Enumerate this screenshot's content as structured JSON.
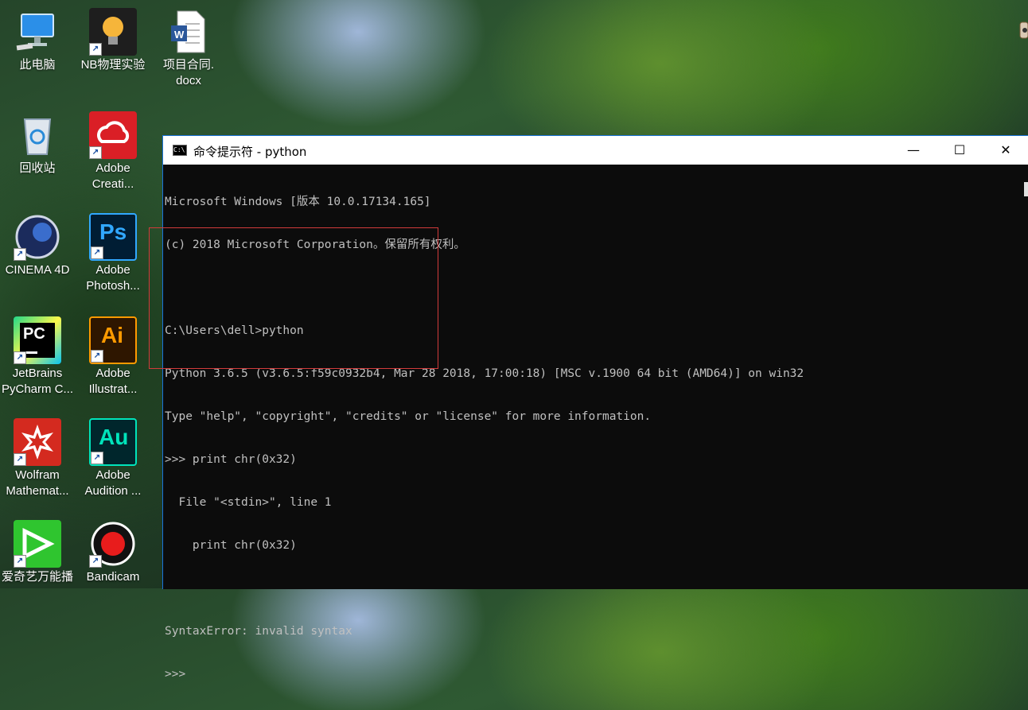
{
  "desktop": {
    "icons": [
      {
        "id": "this-pc",
        "label": "此电脑",
        "label2": ""
      },
      {
        "id": "nb",
        "label": "NB物理实验",
        "label2": ""
      },
      {
        "id": "word",
        "label": "项目合同.",
        "label2": "docx"
      },
      {
        "id": "recycle",
        "label": "回收站",
        "label2": ""
      },
      {
        "id": "acc",
        "label": "Adobe",
        "label2": "Creati..."
      },
      {
        "id": "c4d",
        "label": "CINEMA 4D",
        "label2": ""
      },
      {
        "id": "ps",
        "label": "Adobe",
        "label2": "Photosh..."
      },
      {
        "id": "pycharm",
        "label": "JetBrains",
        "label2": "PyCharm C..."
      },
      {
        "id": "ai",
        "label": "Adobe",
        "label2": "Illustrat..."
      },
      {
        "id": "wolfram",
        "label": "Wolfram",
        "label2": "Mathemat..."
      },
      {
        "id": "au",
        "label": "Adobe",
        "label2": "Audition ..."
      },
      {
        "id": "iqiyi",
        "label": "爱奇艺万能播",
        "label2": ""
      },
      {
        "id": "bandicam",
        "label": "Bandicam",
        "label2": ""
      }
    ],
    "glyphs": {
      "ps": "Ps",
      "ai": "Ai",
      "au": "Au",
      "pc": "PC",
      "word": "W",
      "shortcut": "↗"
    }
  },
  "window": {
    "title": "命令提示符 - python",
    "icon_text": "C:\\",
    "controls": {
      "minimize": "—",
      "maximize": "☐",
      "close": "✕"
    }
  },
  "console": {
    "lines": [
      "Microsoft Windows [版本 10.0.17134.165]",
      "(c) 2018 Microsoft Corporation。保留所有权利。",
      "",
      "C:\\Users\\dell>python",
      "Python 3.6.5 (v3.6.5:f59c0932b4, Mar 28 2018, 17:00:18) [MSC v.1900 64 bit (AMD64)] on win32",
      "Type \"help\", \"copyright\", \"credits\" or \"license\" for more information.",
      ">>> print chr(0x32)",
      "  File \"<stdin>\", line 1",
      "    print chr(0x32)",
      "",
      "SyntaxError: invalid syntax",
      ">>>"
    ]
  },
  "colors": {
    "title_bar_bg": "#ffffff",
    "window_border": "#1a73d9",
    "console_bg": "#0c0c0c",
    "console_text": "#c0c0c0",
    "highlight_box": "#d23b3b"
  }
}
